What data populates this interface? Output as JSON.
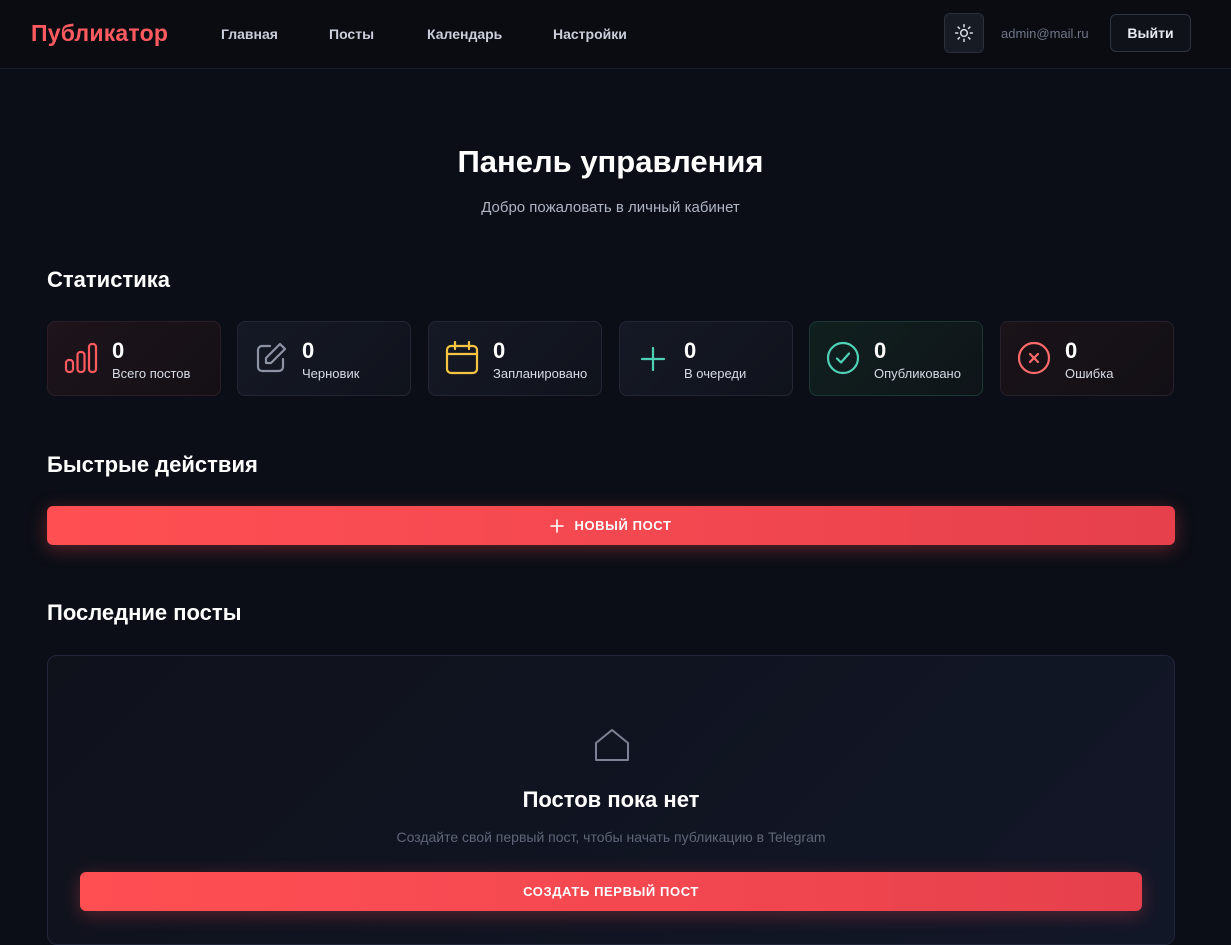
{
  "header": {
    "logo": "Публикатор",
    "nav": [
      {
        "label": "Главная"
      },
      {
        "label": "Посты"
      },
      {
        "label": "Календарь"
      },
      {
        "label": "Настройки"
      }
    ],
    "user_email": "admin@mail.ru",
    "logout_label": "Выйти",
    "theme_icon": "sun-icon"
  },
  "page": {
    "title": "Панель управления",
    "subtitle": "Добро пожаловать в личный кабинет"
  },
  "stats": {
    "title": "Статистика",
    "items": [
      {
        "value": "0",
        "label": "Всего постов",
        "icon": "bar-chart-icon",
        "color": "#ff5a5f"
      },
      {
        "value": "0",
        "label": "Черновик",
        "icon": "edit-icon",
        "color": "#8d93a3"
      },
      {
        "value": "0",
        "label": "Запланировано",
        "icon": "calendar-icon",
        "color": "#f5c542"
      },
      {
        "value": "0",
        "label": "В очереди",
        "icon": "plus-icon",
        "color": "#4fd1b5"
      },
      {
        "value": "0",
        "label": "Опубликовано",
        "icon": "check-circle-icon",
        "color": "#4fd1b5"
      },
      {
        "value": "0",
        "label": "Ошибка",
        "icon": "x-circle-icon",
        "color": "#ff6a6a"
      }
    ]
  },
  "quick_actions": {
    "title": "Быстрые действия",
    "new_post_label": "НОВЫЙ ПОСТ"
  },
  "recent_posts": {
    "title": "Последние посты",
    "empty_icon": "home-icon",
    "empty_title": "Постов пока нет",
    "empty_subtitle": "Создайте свой первый пост, чтобы начать публикацию в Telegram",
    "create_first_label": "СОЗДАТЬ ПЕРВЫЙ ПОСТ"
  },
  "colors": {
    "accent": "#ff4f53",
    "background": "#0b0e16"
  }
}
